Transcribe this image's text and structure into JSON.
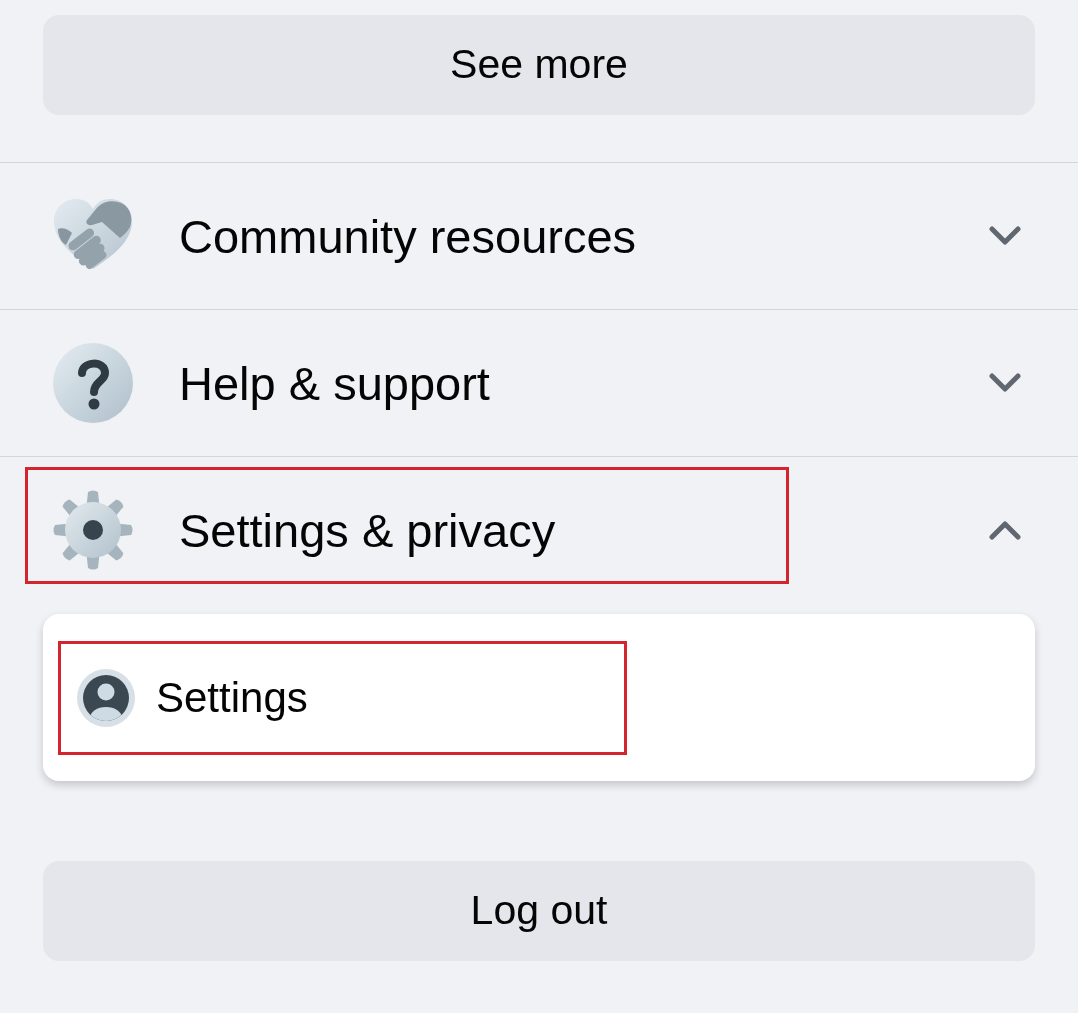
{
  "see_more_button": {
    "label": "See more"
  },
  "sections": [
    {
      "kind": "community",
      "label": "Community resources",
      "expanded": false,
      "highlighted": false
    },
    {
      "kind": "help",
      "label": "Help & support",
      "expanded": false,
      "highlighted": false
    },
    {
      "kind": "settings",
      "label": "Settings & privacy",
      "expanded": true,
      "highlighted": true,
      "children": [
        {
          "kind": "account",
          "label": "Settings",
          "highlighted": true
        }
      ]
    }
  ],
  "log_out_button": {
    "label": "Log out"
  }
}
